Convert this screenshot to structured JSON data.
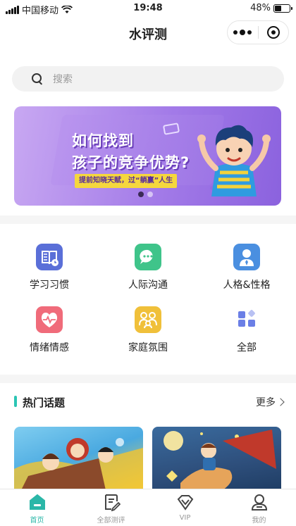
{
  "status_bar": {
    "carrier": "中国移动",
    "time": "19:48",
    "battery_percent": "48%",
    "battery_level": 0.48
  },
  "nav": {
    "title": "水评测"
  },
  "search": {
    "placeholder": "搜索"
  },
  "banner": {
    "line1": "如何找到",
    "line2": "孩子的竞争优势?",
    "tag": "提前知晓天赋，过“躺赢”人生",
    "slide_count": 2,
    "active_slide": 1
  },
  "categories": [
    {
      "label": "学习习惯",
      "icon": "book-icon",
      "color": "#5a6fd8"
    },
    {
      "label": "人际沟通",
      "icon": "chat-bubble-icon",
      "color": "#3fc48a"
    },
    {
      "label": "人格&性格",
      "icon": "person-badge-icon",
      "color": "#4a8fe0"
    },
    {
      "label": "情绪情感",
      "icon": "heart-pulse-icon",
      "color": "#f06b7a"
    },
    {
      "label": "家庭氛围",
      "icon": "family-icon",
      "color": "#f0c03a"
    },
    {
      "label": "全部",
      "icon": "grid-icon",
      "color": "#6b7fe6"
    }
  ],
  "hot_topics": {
    "title": "热门话题",
    "more_label": "更多"
  },
  "tabbar": {
    "items": [
      {
        "label": "首页",
        "icon": "home-icon",
        "active": true
      },
      {
        "label": "全部测评",
        "icon": "edit-note-icon",
        "active": false
      },
      {
        "label": "VIP",
        "icon": "vip-diamond-icon",
        "active": false
      },
      {
        "label": "我的",
        "icon": "user-icon",
        "active": false
      }
    ]
  },
  "colors": {
    "accent": "#2bb7a8",
    "banner_purple": "#a37be8"
  }
}
